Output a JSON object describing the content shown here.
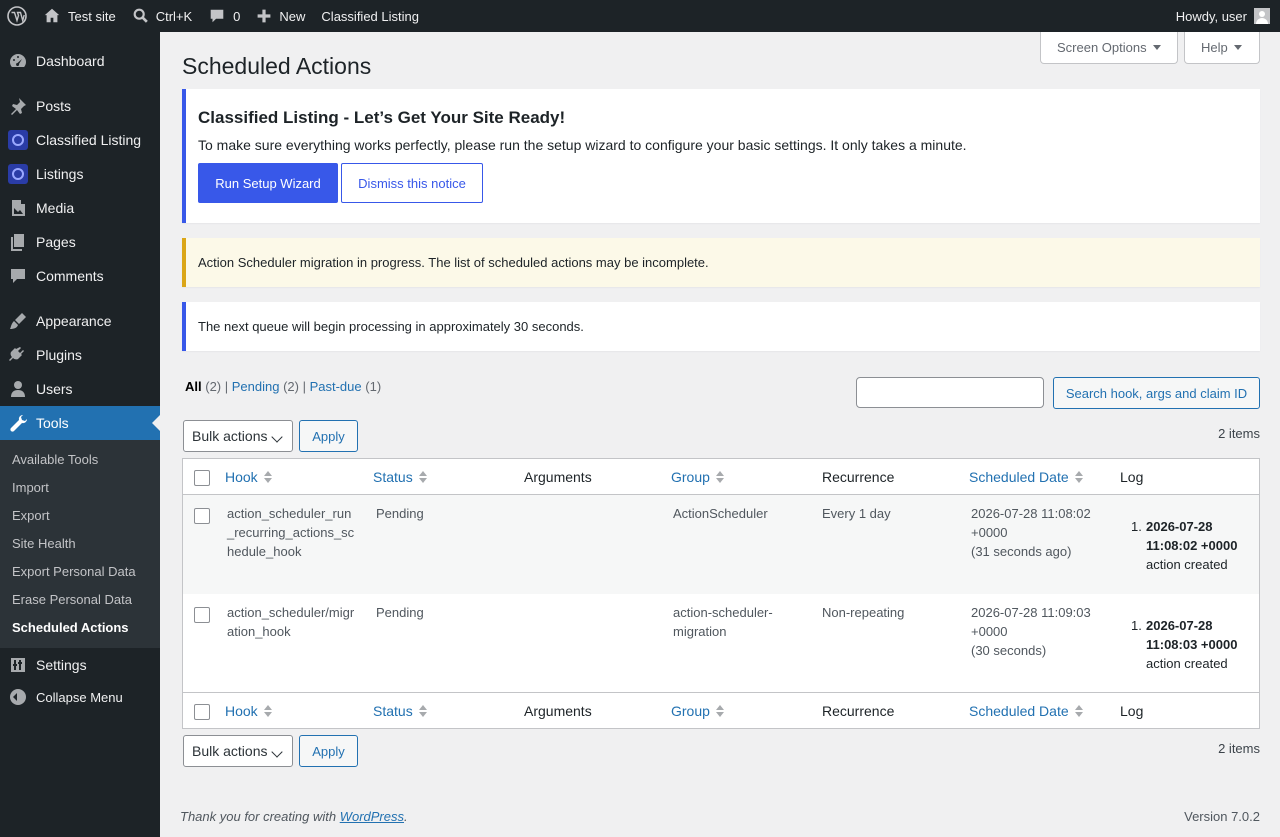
{
  "adminbar": {
    "site_name": "Test site",
    "search_shortcut": "Ctrl+K",
    "comments_count": "0",
    "new_label": "New",
    "plugin_link": "Classified Listing",
    "greeting": "Howdy, user"
  },
  "sidebar": {
    "items": [
      {
        "label": "Dashboard",
        "icon": "dashboard-icon"
      },
      {
        "label": "Posts",
        "icon": "pin-icon"
      },
      {
        "label": "Classified Listing",
        "icon": "classified-listing-icon"
      },
      {
        "label": "Listings",
        "icon": "listings-icon"
      },
      {
        "label": "Media",
        "icon": "media-icon"
      },
      {
        "label": "Pages",
        "icon": "pages-icon"
      },
      {
        "label": "Comments",
        "icon": "comment-icon"
      },
      {
        "label": "Appearance",
        "icon": "brush-icon"
      },
      {
        "label": "Plugins",
        "icon": "plug-icon"
      },
      {
        "label": "Users",
        "icon": "user-icon"
      },
      {
        "label": "Tools",
        "icon": "wrench-icon"
      },
      {
        "label": "Settings",
        "icon": "sliders-icon"
      }
    ],
    "submenu": [
      "Available Tools",
      "Import",
      "Export",
      "Site Health",
      "Export Personal Data",
      "Erase Personal Data",
      "Scheduled Actions"
    ],
    "collapse_label": "Collapse Menu"
  },
  "screen_options": "Screen Options",
  "help": "Help",
  "page_title": "Scheduled Actions",
  "setup_notice": {
    "title": "Classified Listing - Let’s Get Your Site Ready!",
    "description": "To make sure everything works perfectly, please run the setup wizard to configure your basic settings. It only takes a minute.",
    "primary_button": "Run Setup Wizard",
    "secondary_button": "Dismiss this notice"
  },
  "migration_notice": "Action Scheduler migration in progress. The list of scheduled actions may be incomplete.",
  "queue_notice": "The next queue will begin processing in approximately 30 seconds.",
  "filters": {
    "all": "All",
    "all_count": "(2)",
    "pending": "Pending",
    "pending_count": "(2)",
    "pastdue": "Past-due",
    "pastdue_count": "(1)"
  },
  "search": {
    "button": "Search hook, args and claim ID",
    "value": ""
  },
  "bulk": {
    "label": "Bulk actions",
    "apply": "Apply",
    "items": "2 items"
  },
  "table": {
    "columns": [
      "Hook",
      "Status",
      "Arguments",
      "Group",
      "Recurrence",
      "Scheduled Date",
      "Log"
    ],
    "rows": [
      {
        "hook": [
          "action_scheduler_run",
          "_recurring_actions_sc",
          "hedule_hook"
        ],
        "status": "Pending",
        "arguments": "",
        "group": [
          "ActionScheduler"
        ],
        "recurrence": "Every 1 day",
        "date": [
          "2026-07-28 11:08:02",
          "+0000",
          "(31 seconds ago)"
        ],
        "log_num": "1.",
        "log_date": [
          "2026-07-28",
          "11:08:02 +0000"
        ],
        "log_msg": "action created"
      },
      {
        "hook": [
          "action_scheduler/migr",
          "ation_hook"
        ],
        "status": "Pending",
        "arguments": "",
        "group": [
          "action-scheduler-",
          "migration"
        ],
        "recurrence": "Non-repeating",
        "date": [
          "2026-07-28 11:09:03",
          "+0000",
          "(30 seconds)"
        ],
        "log_num": "1.",
        "log_date": [
          "2026-07-28",
          "11:08:03 +0000"
        ],
        "log_msg": "action created"
      }
    ]
  },
  "footer": {
    "thanks_prefix": "Thank you for creating with ",
    "wp_link": "WordPress",
    "thanks_suffix": ".",
    "version": "Version 7.0.2"
  }
}
